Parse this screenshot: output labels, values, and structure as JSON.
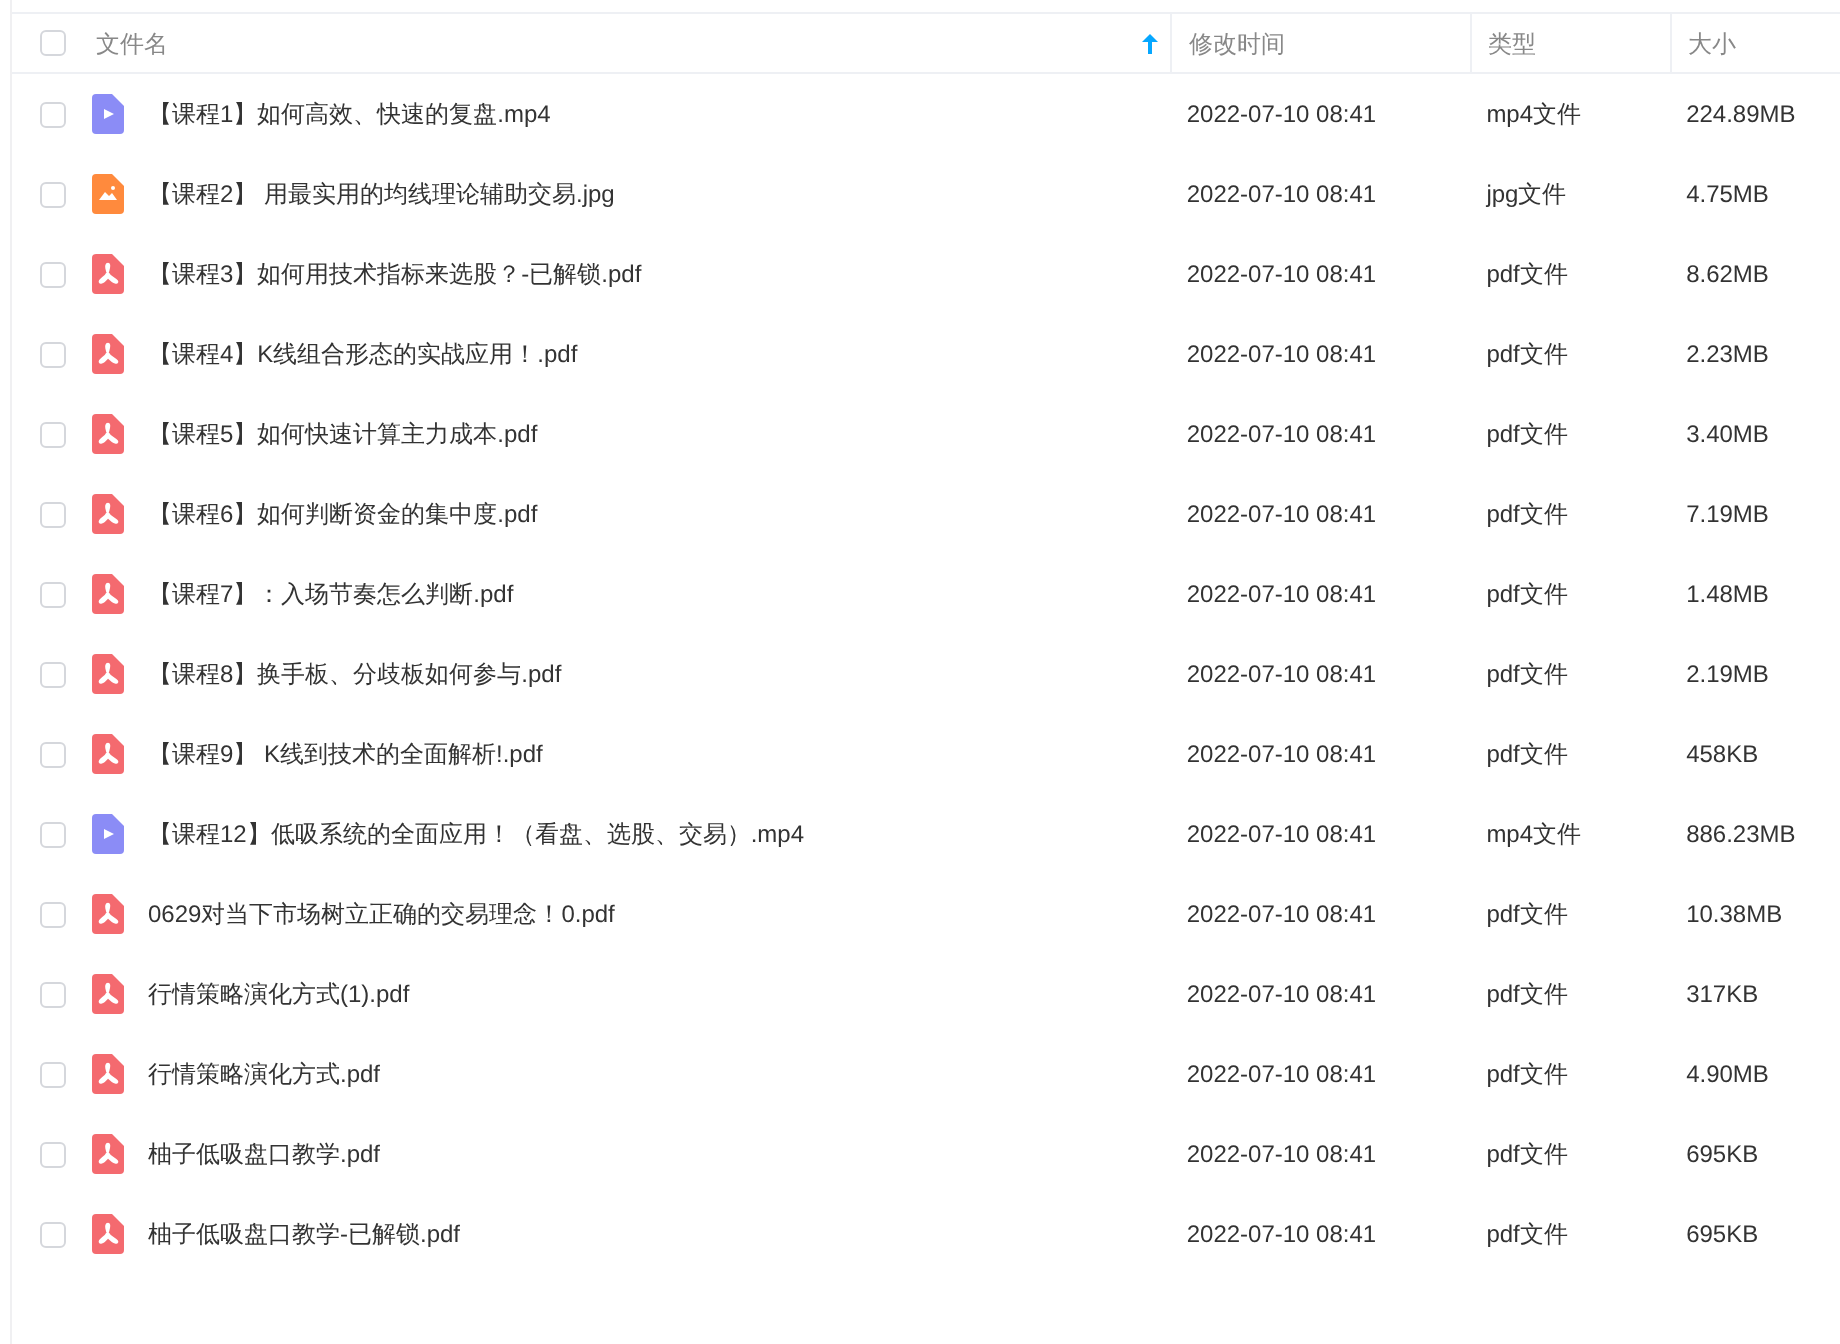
{
  "table": {
    "select_all": {
      "checked": false
    },
    "columns": [
      {
        "label": "文件名",
        "sorted": true
      },
      {
        "label": "修改时间",
        "sorted": false
      },
      {
        "label": "类型",
        "sorted": false
      },
      {
        "label": "大小",
        "sorted": false
      }
    ],
    "rows": [
      {
        "kind": "video",
        "checked": false,
        "name": "【课程1】如何高效、快速的复盘.mp4",
        "modified": "2022-07-10 08:41",
        "type": "mp4文件",
        "size": "224.89MB"
      },
      {
        "kind": "image",
        "checked": false,
        "name": "【课程2】 用最实用的均线理论辅助交易.jpg",
        "modified": "2022-07-10 08:41",
        "type": "jpg文件",
        "size": "4.75MB"
      },
      {
        "kind": "pdf",
        "checked": false,
        "name": "【课程3】如何用技术指标来选股？-已解锁.pdf",
        "modified": "2022-07-10 08:41",
        "type": "pdf文件",
        "size": "8.62MB"
      },
      {
        "kind": "pdf",
        "checked": false,
        "name": "【课程4】K线组合形态的实战应用！.pdf",
        "modified": "2022-07-10 08:41",
        "type": "pdf文件",
        "size": "2.23MB"
      },
      {
        "kind": "pdf",
        "checked": false,
        "name": "【课程5】如何快速计算主力成本.pdf",
        "modified": "2022-07-10 08:41",
        "type": "pdf文件",
        "size": "3.40MB"
      },
      {
        "kind": "pdf",
        "checked": false,
        "name": "【课程6】如何判断资金的集中度.pdf",
        "modified": "2022-07-10 08:41",
        "type": "pdf文件",
        "size": "7.19MB"
      },
      {
        "kind": "pdf",
        "checked": false,
        "name": "【课程7】：入场节奏怎么判断.pdf",
        "modified": "2022-07-10 08:41",
        "type": "pdf文件",
        "size": "1.48MB"
      },
      {
        "kind": "pdf",
        "checked": false,
        "name": "【课程8】换手板、分歧板如何参与.pdf",
        "modified": "2022-07-10 08:41",
        "type": "pdf文件",
        "size": "2.19MB"
      },
      {
        "kind": "pdf",
        "checked": false,
        "name": "【课程9】 K线到技术的全面解析!.pdf",
        "modified": "2022-07-10 08:41",
        "type": "pdf文件",
        "size": "458KB"
      },
      {
        "kind": "video",
        "checked": false,
        "name": "【课程12】低吸系统的全面应用！（看盘、选股、交易）.mp4",
        "modified": "2022-07-10 08:41",
        "type": "mp4文件",
        "size": "886.23MB"
      },
      {
        "kind": "pdf",
        "checked": false,
        "name": "0629对当下市场树立正确的交易理念！0.pdf",
        "modified": "2022-07-10 08:41",
        "type": "pdf文件",
        "size": "10.38MB"
      },
      {
        "kind": "pdf",
        "checked": false,
        "name": "行情策略演化方式(1).pdf",
        "modified": "2022-07-10 08:41",
        "type": "pdf文件",
        "size": "317KB"
      },
      {
        "kind": "pdf",
        "checked": false,
        "name": "行情策略演化方式.pdf",
        "modified": "2022-07-10 08:41",
        "type": "pdf文件",
        "size": "4.90MB"
      },
      {
        "kind": "pdf",
        "checked": false,
        "name": "柚子低吸盘口教学.pdf",
        "modified": "2022-07-10 08:41",
        "type": "pdf文件",
        "size": "695KB"
      },
      {
        "kind": "pdf",
        "checked": false,
        "name": "柚子低吸盘口教学-已解锁.pdf",
        "modified": "2022-07-10 08:41",
        "type": "pdf文件",
        "size": "695KB"
      }
    ]
  }
}
